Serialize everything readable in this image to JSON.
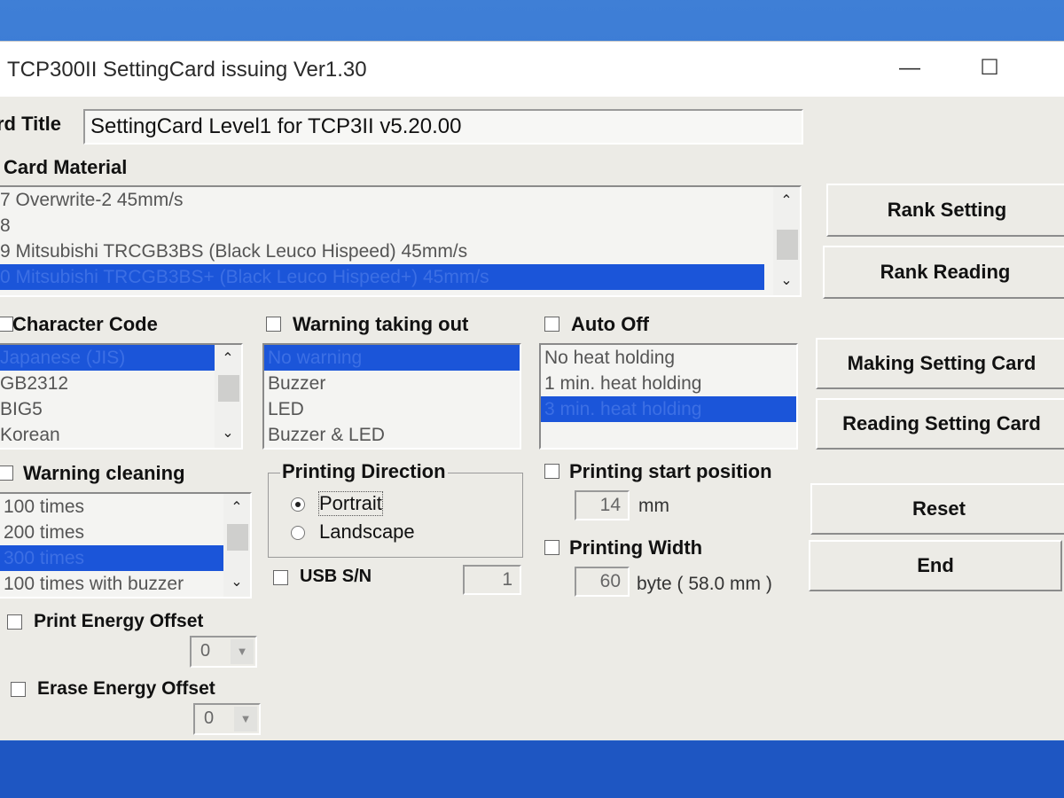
{
  "window": {
    "title": "TCP300II SettingCard issuing Ver1.30",
    "minimize_glyph": "—",
    "maximize_glyph": "☐"
  },
  "card_title": {
    "label": "rd Title",
    "value": "SettingCard Level1 for TCP3II v5.20.00"
  },
  "card_material": {
    "label": "Card Material",
    "items": [
      "7  Overwrite-2 45mm/s",
      "8",
      "9  Mitsubishi TRCGB3BS  (Black Leuco Hispeed) 45mm/s",
      "0  Mitsubishi TRCGB3BS+ (Black Leuco Hispeed+) 45mm/s"
    ],
    "selected_index": 3
  },
  "character_code": {
    "label": "Character Code",
    "items": [
      "Japanese (JIS)",
      "GB2312",
      "BIG5",
      "Korean"
    ],
    "selected_index": 0
  },
  "warning_taking_out": {
    "label": "Warning taking out",
    "items": [
      "No warning",
      "Buzzer",
      "LED",
      "Buzzer & LED"
    ],
    "selected_index": 0
  },
  "auto_off": {
    "label": "Auto Off",
    "items": [
      "No heat holding",
      "1 min. heat holding",
      "3 min. heat holding"
    ],
    "selected_index": 2
  },
  "warning_cleaning": {
    "label": "Warning cleaning",
    "items": [
      "100 times",
      "200 times",
      "300 times",
      "100 times with buzzer"
    ],
    "selected_index": 2
  },
  "printing_direction": {
    "label": "Printing Direction",
    "options": [
      "Portrait",
      "Landscape"
    ],
    "selected": "Portrait"
  },
  "usb_sn": {
    "label": "USB S/N",
    "value": "1"
  },
  "printing_start_position": {
    "label": "Printing start position",
    "value": "14",
    "unit": "mm"
  },
  "printing_width": {
    "label": "Printing Width",
    "value": "60",
    "unit": "byte ( 58.0 mm )"
  },
  "print_energy_offset": {
    "label": "Print Energy Offset",
    "value": "0"
  },
  "erase_energy_offset": {
    "label": "Erase Energy Offset",
    "value": "0"
  },
  "buttons": {
    "rank_setting": "Rank Setting",
    "rank_reading": "Rank Reading",
    "making_setting_card": "Making Setting Card",
    "reading_setting_card": "Reading Setting Card",
    "reset": "Reset",
    "end": "End"
  },
  "icons": {
    "scroll_up": "⌃",
    "scroll_down": "⌄",
    "combo_arrow": "▼"
  }
}
